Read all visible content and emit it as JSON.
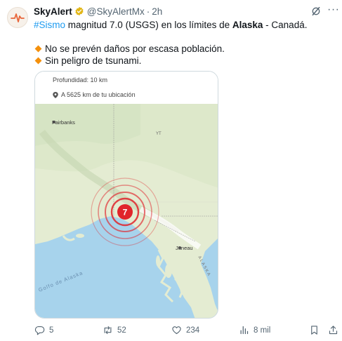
{
  "account": {
    "name": "SkyAlert",
    "handle": "@SkyAlertMx",
    "separator": "·",
    "time": "2h"
  },
  "tweet": {
    "hashtag": "#Sismo",
    "text_part1": " magnitud 7.0 (USGS) en los límites de ",
    "region_bold": "Alaska",
    "text_part2": " - Canadá.",
    "bullets": [
      "No se prevén daños por escasa población.",
      "Sin peligro de tsunami."
    ]
  },
  "card": {
    "depth": "Profundidad: 10 km",
    "distance": "A 5625 km de tu ubicación",
    "magnitude_badge": "7",
    "map_labels": {
      "fairbanks": "Fairbanks",
      "yukon": "YT",
      "juneau": "Juneau",
      "gulf": "Golfo de Alaska",
      "alaska_vertical": "ALASKA"
    }
  },
  "actions": {
    "replies": "5",
    "retweets": "52",
    "likes": "234",
    "views": "8 mil"
  },
  "colors": {
    "link": "#1d9bf0",
    "muted": "#536471",
    "bullet": "#f4900c",
    "quake": "#e0242b",
    "ocean": "#a7d3ec",
    "land": "#e4ecd2"
  },
  "icons": [
    "avatar-alert-logo",
    "verified-badge-icon",
    "grok-icon",
    "more-icon",
    "location-pin-icon",
    "reply-icon",
    "retweet-icon",
    "like-icon",
    "views-icon",
    "bookmark-icon",
    "share-icon"
  ]
}
